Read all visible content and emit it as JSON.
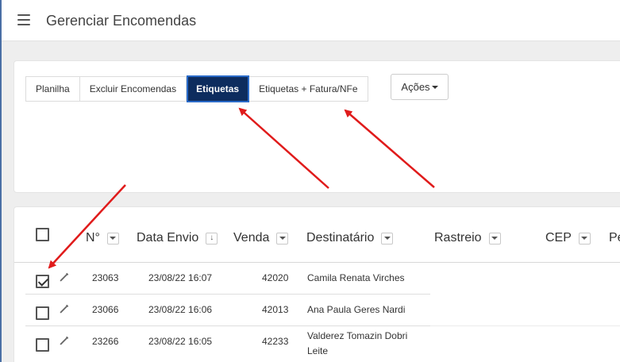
{
  "header": {
    "title": "Gerenciar Encomendas",
    "menu_icon": "hamburger-menu-icon"
  },
  "tabs": [
    {
      "label": "Planilha",
      "active": false
    },
    {
      "label": "Excluir Encomendas",
      "active": false
    },
    {
      "label": "Etiquetas",
      "active": true
    },
    {
      "label": "Etiquetas + Fatura/NFe",
      "active": false
    }
  ],
  "actions": {
    "label": "Ações"
  },
  "table": {
    "columns": [
      {
        "label": "N°",
        "sort": "dropdown"
      },
      {
        "label": "Data Envio",
        "sort": "arrow-down"
      },
      {
        "label": "Venda",
        "sort": "dropdown"
      },
      {
        "label": "Destinatário",
        "sort": "dropdown"
      },
      {
        "label": "Rastreio",
        "sort": "dropdown"
      },
      {
        "label": "CEP",
        "sort": "dropdown"
      },
      {
        "label": "Pe",
        "sort": "none"
      }
    ],
    "rows": [
      {
        "checked": true,
        "numero": "23063",
        "data_envio": "23/08/22 16:07",
        "venda": "42020",
        "destinatario": "Camila Renata Virches"
      },
      {
        "checked": false,
        "numero": "23066",
        "data_envio": "23/08/22 16:06",
        "venda": "42013",
        "destinatario": "Ana Paula Geres Nardi"
      },
      {
        "checked": false,
        "numero": "23266",
        "data_envio": "23/08/22 16:05",
        "venda": "42233",
        "destinatario_line1": "Valderez Tomazin Dobri",
        "destinatario_line2": "Leite"
      }
    ]
  },
  "colors": {
    "active_tab": "#0d2c5e",
    "annotation_arrow": "#e01b1b",
    "active_outline": "#2a6bc9"
  }
}
